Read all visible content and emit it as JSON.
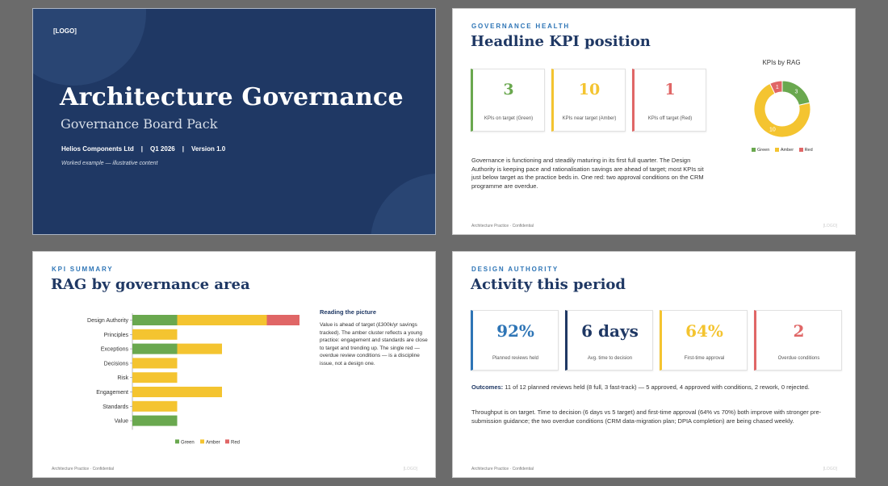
{
  "colors": {
    "navy": "#1f3864",
    "accent_blue": "#2e75b6",
    "green": "#6aa84f",
    "amber": "#f4c430",
    "red": "#e06666"
  },
  "slide1": {
    "logo": "[LOGO]",
    "title": "Architecture Governance",
    "subtitle": "Governance Board Pack",
    "company": "Helios Components Ltd",
    "sep": "|",
    "quarter": "Q1 2026",
    "version": "Version 1.0",
    "note": "Worked example — illustrative content"
  },
  "slide2": {
    "eyebrow": "GOVERNANCE HEALTH",
    "title": "Headline KPI position",
    "cards": [
      {
        "value": "3",
        "label": "KPIs on target (Green)"
      },
      {
        "value": "10",
        "label": "KPIs near target (Amber)"
      },
      {
        "value": "1",
        "label": "KPIs off target (Red)"
      }
    ],
    "paragraph": "Governance is functioning and steadily maturing in its first full quarter. The Design Authority is keeping pace and rationalisation savings are ahead of target; most KPIs sit just below target as the practice beds in. One red: two approval conditions on the CRM programme are overdue.",
    "footer": "Architecture Practice · Confidential",
    "footer_logo": "[LOGO]"
  },
  "slide3": {
    "eyebrow": "KPI SUMMARY",
    "title": "RAG by governance area",
    "reading_title": "Reading the picture",
    "reading_text": "Value is ahead of target (£300k/yr savings tracked). The amber cluster reflects a young practice: engagement and standards are close to target and trending up. The single red — overdue review conditions — is a discipline issue, not a design one.",
    "footer": "Architecture Practice · Confidential",
    "footer_logo": "[LOGO]"
  },
  "slide4": {
    "eyebrow": "DESIGN AUTHORITY",
    "title": "Activity this period",
    "cards": [
      {
        "value": "92%",
        "label": "Planned reviews held"
      },
      {
        "value": "6 days",
        "label": "Avg. time to decision"
      },
      {
        "value": "64%",
        "label": "First-time approval"
      },
      {
        "value": "2",
        "label": "Overdue conditions"
      }
    ],
    "outcomes_label": "Outcomes:",
    "outcomes_text": "11 of 12 planned reviews held (8 full, 3 fast-track) — 5 approved, 4 approved with conditions, 2 rework, 0 rejected.",
    "throughput": "Throughput is on target. Time to decision (6 days vs 5 target) and first-time approval (64% vs 70%) both improve with stronger pre-submission guidance; the two overdue conditions (CRM data-migration plan; DPIA completion) are being chased weekly.",
    "footer": "Architecture Practice · Confidential",
    "footer_logo": "[LOGO]"
  },
  "chart_data": [
    {
      "type": "pie",
      "title": "KPIs by RAG",
      "categories": [
        "Green",
        "Amber",
        "Red"
      ],
      "values": [
        3,
        10,
        1
      ],
      "colors": [
        "#6aa84f",
        "#f4c430",
        "#e06666"
      ],
      "legend": "bottom"
    },
    {
      "type": "bar",
      "orientation": "horizontal",
      "stacked": true,
      "categories": [
        "Design Authority",
        "Principles",
        "Exceptions",
        "Decisions",
        "Risk",
        "Engagement",
        "Standards",
        "Value"
      ],
      "series": [
        {
          "name": "Green",
          "color": "#6aa84f",
          "values": [
            1,
            0,
            1,
            0,
            0,
            0,
            0,
            1
          ]
        },
        {
          "name": "Amber",
          "color": "#f4c430",
          "values": [
            2,
            1,
            1,
            1,
            1,
            2,
            1,
            0
          ]
        },
        {
          "name": "Red",
          "color": "#e06666",
          "values": [
            1,
            0,
            0,
            0,
            0,
            0,
            0,
            0
          ]
        }
      ],
      "xlim": [
        0,
        4
      ],
      "grid": false,
      "legend": "bottom"
    }
  ]
}
